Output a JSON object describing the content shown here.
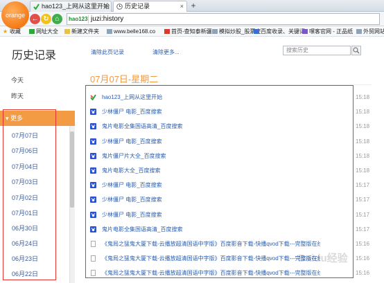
{
  "browser": {
    "logo_text": "orange",
    "tabs": [
      {
        "label": "hao123_上网从这里开始",
        "active": false
      },
      {
        "label": "历史记录",
        "active": true
      }
    ],
    "new_tab": "+",
    "address": {
      "badge": "hao123",
      "url": "juzi:history"
    },
    "bookmarks": [
      "收藏",
      "网址大全",
      "新建文件夹",
      "www.belle168.co",
      "首页-查知泰新疆",
      "模拟炒股_股票交",
      "百度收录、关键词",
      "嘿客官网 - 正品纸",
      "外贸网站"
    ]
  },
  "page": {
    "title": "历史记录",
    "clear_page": "清除此页记录",
    "clear_more": "清除更多...",
    "search_placeholder": "搜索历史"
  },
  "sidebar": {
    "today": "今天",
    "yesterday": "昨天",
    "more": "更多",
    "dates": [
      "07月07日",
      "07月06日",
      "07月04日",
      "07月03日",
      "07月02日",
      "07月01日",
      "06月30日",
      "06月24日",
      "06月23日",
      "06月22日"
    ]
  },
  "main": {
    "date_heading": "07月07日-星期二",
    "entries": [
      {
        "title": "hao123_上网从这里开始",
        "time": "15:18",
        "icon": "hao123-icon"
      },
      {
        "title": "少林僵尸 电影_百度搜索",
        "time": "15:18",
        "icon": "baidu-icon"
      },
      {
        "title": "鬼片电影全集国语高清_百度搜索",
        "time": "15:18",
        "icon": "baidu-icon"
      },
      {
        "title": "少林僵尸 电影_百度搜索",
        "time": "15:18",
        "icon": "baidu-icon"
      },
      {
        "title": "鬼片僵尸片大全_百度搜索",
        "time": "15:18",
        "icon": "baidu-icon"
      },
      {
        "title": "鬼片电影大全_百度搜索",
        "time": "15:18",
        "icon": "baidu-icon"
      },
      {
        "title": "少林僵尸 电影_百度搜索",
        "time": "15:17",
        "icon": "baidu-icon"
      },
      {
        "title": "少林僵尸 电影_百度搜索",
        "time": "15:17",
        "icon": "baidu-icon"
      },
      {
        "title": "少林僵尸 电影_百度搜索",
        "time": "15:17",
        "icon": "baidu-icon"
      },
      {
        "title": "鬼片电影全集国语高清_百度搜索",
        "time": "15:17",
        "icon": "baidu-icon"
      },
      {
        "title": "《鬼局之猛鬼大厦下载-云播放超清国语中字版》百度影音下载-快播qvod下载---完整版在线观看...",
        "time": "15:16",
        "icon": "page-icon"
      },
      {
        "title": "《鬼局之猛鬼大厦下载-云播放超清国语中字版》百度影音下载-快播qvod下载---完整版在线观看...",
        "time": "15:16",
        "icon": "page-icon"
      },
      {
        "title": "《鬼局之猛鬼大厦下载-云播放超清国语中字版》百度影音下载-快播qvod下载---完整版在线观看...",
        "time": "15:16",
        "icon": "page-icon"
      }
    ]
  },
  "watermark": "Baidu经验"
}
